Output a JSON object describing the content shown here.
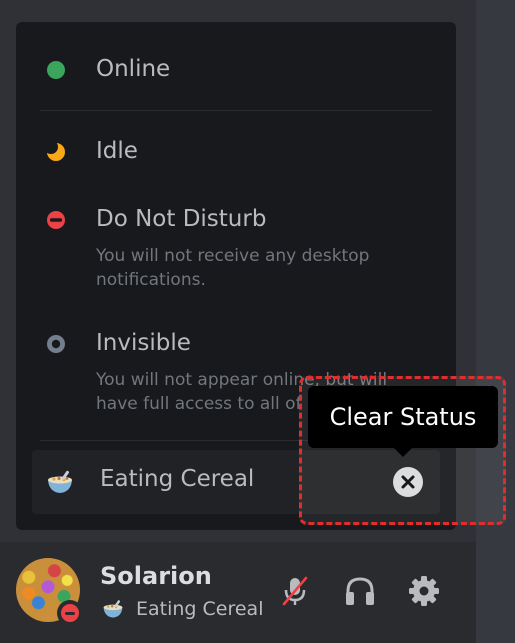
{
  "status_menu": {
    "items": [
      {
        "label": "Online",
        "description": "",
        "color": "#3ba55d"
      },
      {
        "label": "Idle",
        "description": "",
        "color": "#faa81a"
      },
      {
        "label": "Do Not Disturb",
        "description": "You will not receive any desktop notifications.",
        "color": "#ed4245"
      },
      {
        "label": "Invisible",
        "description": "You will not appear online, but will have full access to all of Discord.",
        "color": "#747f8d"
      }
    ],
    "custom_status": {
      "emoji": "bowl-of-cereal-emoji",
      "text": "Eating Cereal",
      "clear_icon": "close-circle-icon"
    }
  },
  "tooltip": {
    "text": "Clear Status"
  },
  "user_panel": {
    "username": "Solarion",
    "status_text": "Eating Cereal",
    "status_emoji": "bowl-of-cereal-emoji",
    "presence": "do-not-disturb",
    "controls": [
      {
        "icon": "microphone-muted-icon"
      },
      {
        "icon": "headphones-icon"
      },
      {
        "icon": "gear-icon"
      }
    ]
  }
}
